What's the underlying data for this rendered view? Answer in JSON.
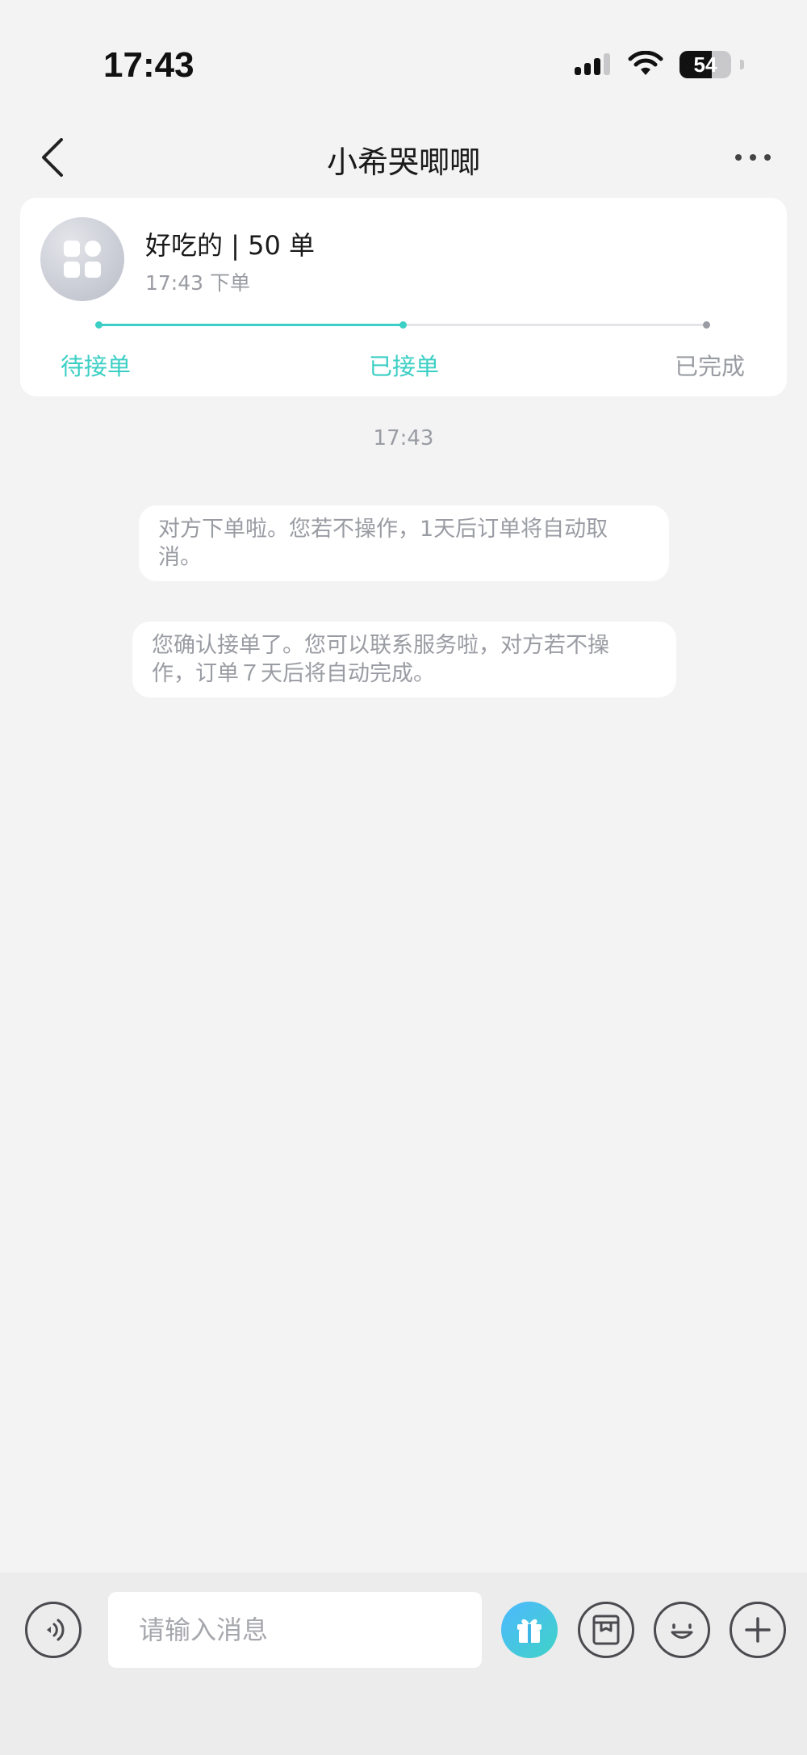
{
  "status_bar": {
    "time": "17:43",
    "battery": "54"
  },
  "nav": {
    "title": "小希哭唧唧"
  },
  "order": {
    "title": "好吃的 | 50 单",
    "subtitle": "17:43 下单",
    "steps": [
      "待接单",
      "已接单",
      "已完成"
    ],
    "progress": 0.5,
    "colors": {
      "active": "#3ccfc5",
      "inactive": "#9a9ca3"
    }
  },
  "chat": {
    "timestamp": "17:43",
    "system_messages": [
      {
        "line1": "对方下单啦。您若不操作，1天后订单将自动取",
        "line2": "消。"
      },
      {
        "line1": "您确认接单了。您可以联系服务啦，对方若不操",
        "line2": "作，订单７天后将自动完成。"
      }
    ]
  },
  "input": {
    "placeholder": "请输入消息"
  },
  "icons": {
    "back": "chevron-left-icon",
    "more": "more-dots-icon",
    "voice": "voice-icon",
    "gift": "gift-icon",
    "order": "order-box-icon",
    "emoji": "emoji-icon",
    "add": "plus-icon"
  }
}
